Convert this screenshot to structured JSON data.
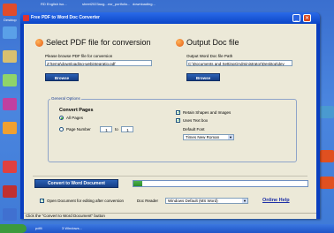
{
  "desktop": {
    "top_labels": [
      "Desktop",
      "RD English iso...",
      "sheet2023aug...",
      "nsr_portfolio...",
      "downloading..."
    ],
    "taskbar_labels": [
      "pdf4",
      "3 Windows..."
    ]
  },
  "window": {
    "title": "Free PDF to Word Doc Converter",
    "min_glyph": "_",
    "close_glyph": "✕"
  },
  "input": {
    "heading": "Select PDF file for conversion",
    "browse_label": "Please browse PDF file for conversion",
    "path_value": "Z:\\temp\\downloading-webintegratio.pdf",
    "browse_button": "Browse"
  },
  "output": {
    "heading": "Output Doc file",
    "path_label": "Output Word Doc file Path",
    "path_value": "C:\\Documents and Settings\\Administrator\\Desktop\\dev",
    "browse_button": "Browse"
  },
  "options": {
    "legend": "General Options",
    "convert_pages": "Convert Pages",
    "all_pages": "All Pages",
    "page_number": "Page Number",
    "page_from": "1",
    "to_label": "to",
    "page_to": "1",
    "retain_shapes": "Retain Shapes and Images",
    "use_text_box": "Uses Text box",
    "default_font_label": "Default Font",
    "default_font_value": "Times New Roman"
  },
  "convert_button": "Convert to Word Document",
  "progress": {
    "value": 0.05,
    "text": "0%"
  },
  "footer": {
    "open_after": "Open Document for editing after conversion",
    "doc_reader_label": "Doc Reader",
    "doc_reader_value": "Windows Default (MS Word)",
    "online_help": "Online Help"
  },
  "status": "Click the \"Convert to Word Document\" button"
}
